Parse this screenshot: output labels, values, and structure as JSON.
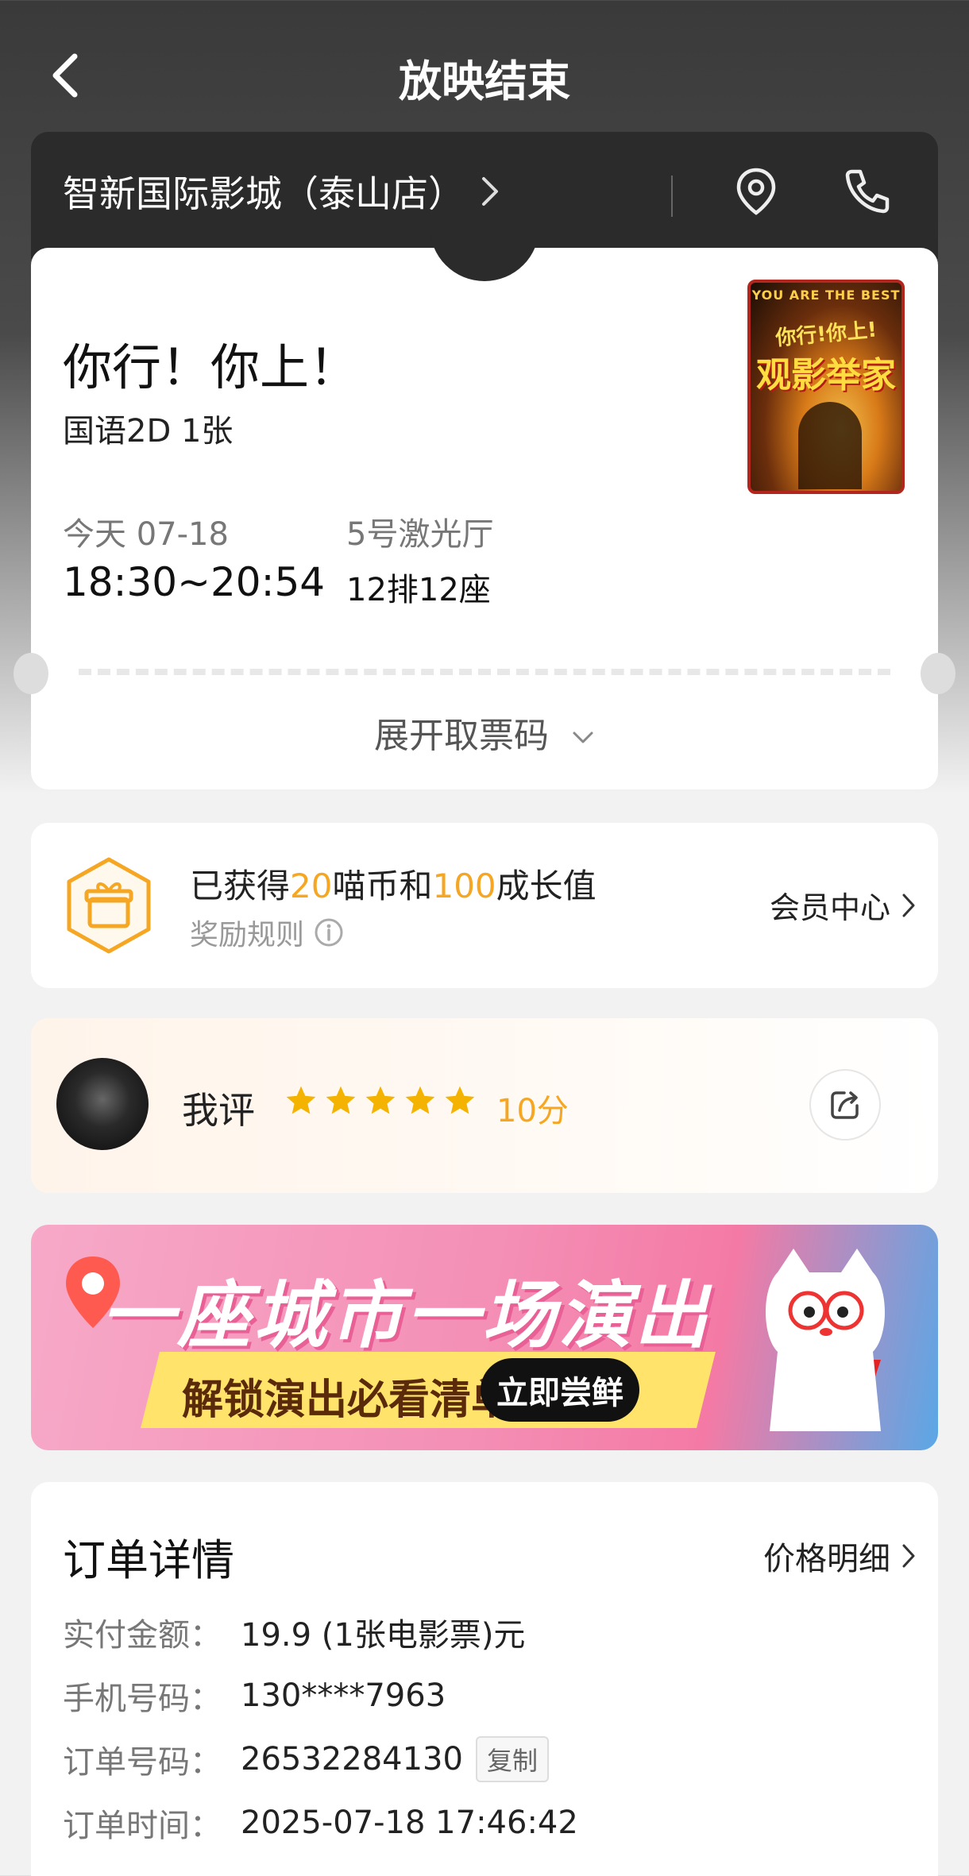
{
  "nav": {
    "title": "放映结束"
  },
  "cinema": {
    "name": "智新国际影城（泰山店）"
  },
  "ticket": {
    "movie_title": "你行！你上！",
    "meta": "国语2D 1张",
    "date_label": "今天 07-18",
    "time": "18:30~20:54",
    "hall": "5号激光厅",
    "seat": "12排12座",
    "expand_label": "展开取票码",
    "poster": {
      "top_text": "YOU ARE THE BEST",
      "line1": "你行!你上!",
      "line2": "观影举家"
    }
  },
  "reward": {
    "prefix": "已获得",
    "coins": "20",
    "mid": "喵币和",
    "growth": "100",
    "suffix": "成长值",
    "rule_label": "奖励规则",
    "member_label": "会员中心"
  },
  "review": {
    "label": "我评",
    "stars": 5,
    "score": "10分"
  },
  "banner": {
    "title": "一座城市一场演出",
    "subtitle": "解锁演出必看清单",
    "cta": "立即尝鲜"
  },
  "order": {
    "title": "订单详情",
    "price_detail_label": "价格明细",
    "rows": [
      {
        "key": "实付金额：",
        "value": "19.9 (1张电影票)元"
      },
      {
        "key": "手机号码：",
        "value": "130****7963"
      },
      {
        "key": "订单号码：",
        "value": "26532284130"
      },
      {
        "key": "订单时间：",
        "value": "2025-07-18 17:46:42"
      }
    ],
    "copy_label": "复制"
  },
  "colors": {
    "accent": "#f5a623",
    "dark_bar": "#2b2b2b"
  },
  "icons": [
    "back-arrow-icon",
    "chevron-right-icon",
    "location-pin-icon",
    "phone-icon",
    "chevron-down-icon",
    "gift-icon",
    "info-icon",
    "star-icon",
    "share-icon"
  ]
}
